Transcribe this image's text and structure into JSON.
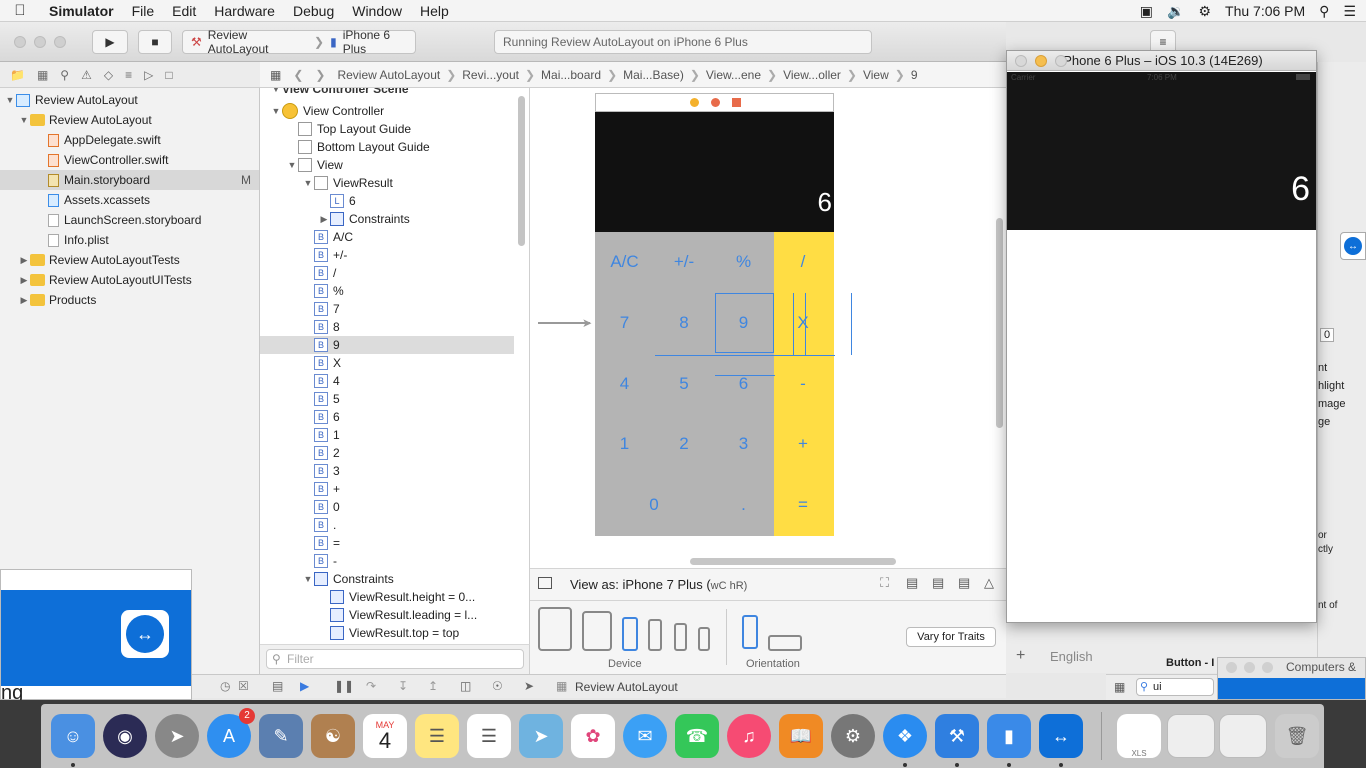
{
  "menubar": {
    "apple_icon": "apple-logo",
    "items": [
      "Simulator",
      "File",
      "Edit",
      "Hardware",
      "Debug",
      "Window",
      "Help"
    ],
    "clock": "Thu 7:06 PM"
  },
  "toolbar": {
    "scheme": "Review AutoLayout",
    "device": "iPhone 6 Plus",
    "activity": "Running Review AutoLayout on iPhone 6 Plus"
  },
  "jumpbar": {
    "crumbs": [
      "Review AutoLayout",
      "Revi...yout",
      "Mai...board",
      "Mai...Base)",
      "View...ene",
      "View...oller",
      "View",
      "9"
    ]
  },
  "navigator": {
    "rows": [
      {
        "label": "Review AutoLayout",
        "kind": "project",
        "indent": 0
      },
      {
        "label": "Review AutoLayout",
        "kind": "folder",
        "indent": 1
      },
      {
        "label": "AppDelegate.swift",
        "kind": "swift",
        "indent": 2
      },
      {
        "label": "ViewController.swift",
        "kind": "swift",
        "indent": 2
      },
      {
        "label": "Main.storyboard",
        "kind": "file",
        "indent": 2,
        "badge": "M",
        "selected": true
      },
      {
        "label": "Assets.xcassets",
        "kind": "assets",
        "indent": 2
      },
      {
        "label": "LaunchScreen.storyboard",
        "kind": "file",
        "indent": 2
      },
      {
        "label": "Info.plist",
        "kind": "file",
        "indent": 2
      },
      {
        "label": "Review AutoLayoutTests",
        "kind": "folder-closed",
        "indent": 0
      },
      {
        "label": "Review AutoLayoutUITests",
        "kind": "folder-closed",
        "indent": 0
      },
      {
        "label": "Products",
        "kind": "folder-closed",
        "indent": 0
      }
    ]
  },
  "outline": {
    "scene_header": "View Controller Scene",
    "rows": [
      {
        "label": "View Controller",
        "icon": "vc",
        "indent": 1
      },
      {
        "label": "Top Layout Guide",
        "icon": "view",
        "indent": 2
      },
      {
        "label": "Bottom Layout Guide",
        "icon": "view",
        "indent": 2
      },
      {
        "label": "View",
        "icon": "view",
        "indent": 2
      },
      {
        "label": "ViewResult",
        "icon": "view",
        "indent": 3
      },
      {
        "label": "6",
        "icon": "L",
        "indent": 4
      },
      {
        "label": "Constraints",
        "icon": "constraints",
        "indent": 4
      },
      {
        "label": "A/C",
        "icon": "B",
        "indent": 3
      },
      {
        "label": "+/-",
        "icon": "B",
        "indent": 3
      },
      {
        "label": "/",
        "icon": "B",
        "indent": 3
      },
      {
        "label": "%",
        "icon": "B",
        "indent": 3
      },
      {
        "label": "7",
        "icon": "B",
        "indent": 3
      },
      {
        "label": "8",
        "icon": "B",
        "indent": 3
      },
      {
        "label": "9",
        "icon": "B",
        "indent": 3,
        "selected": true
      },
      {
        "label": "X",
        "icon": "B",
        "indent": 3
      },
      {
        "label": "4",
        "icon": "B",
        "indent": 3
      },
      {
        "label": "5",
        "icon": "B",
        "indent": 3
      },
      {
        "label": "6",
        "icon": "B",
        "indent": 3
      },
      {
        "label": "1",
        "icon": "B",
        "indent": 3
      },
      {
        "label": "2",
        "icon": "B",
        "indent": 3
      },
      {
        "label": "3",
        "icon": "B",
        "indent": 3
      },
      {
        "label": "+",
        "icon": "B",
        "indent": 3
      },
      {
        "label": "0",
        "icon": "B",
        "indent": 3
      },
      {
        "label": ".",
        "icon": "B",
        "indent": 3
      },
      {
        "label": "=",
        "icon": "B",
        "indent": 3
      },
      {
        "label": "-",
        "icon": "B",
        "indent": 3
      },
      {
        "label": "Constraints",
        "icon": "constraints",
        "indent": 3
      },
      {
        "label": "ViewResult.height = 0...",
        "icon": "constraint",
        "indent": 4
      },
      {
        "label": "ViewResult.leading = l...",
        "icon": "constraint",
        "indent": 4
      },
      {
        "label": "ViewResult.top = top",
        "icon": "constraint",
        "indent": 4
      }
    ],
    "filter_placeholder": "Filter"
  },
  "calculator": {
    "display_value": "6",
    "rows": [
      [
        "A/C",
        "+/-",
        "%",
        "/"
      ],
      [
        "7",
        "8",
        "9",
        "X"
      ],
      [
        "4",
        "5",
        "6",
        "-"
      ],
      [
        "1",
        "2",
        "3",
        "+"
      ],
      [
        "0",
        "",
        ".",
        "="
      ]
    ],
    "colors": {
      "display": "#111111",
      "keys": "#b4b4b4",
      "operators": "#ffdd44",
      "key_text": "#3f86e0"
    }
  },
  "canvas_bottom": {
    "view_as": "View as: iPhone 7 Plus (",
    "size_class": "wC hR)",
    "device_label": "Device",
    "orientation_label": "Orientation",
    "vary_button": "Vary for Traits"
  },
  "statusbar": {
    "label": "Review AutoLayout"
  },
  "simulator": {
    "title": "iPhone 6 Plus – iOS 10.3 (14E269)",
    "carrier": "Carrier",
    "time": "7:06 PM",
    "display_value": "6"
  },
  "inspector": {
    "fragments": [
      "nt",
      "hlight",
      "mage",
      "ge",
      "or",
      "ctly",
      "nt of",
      "0"
    ],
    "language": "English",
    "search_value": "ui",
    "button_label": "Button - I"
  },
  "teamviewer": {
    "right_title": "Computers &",
    "left_text": "ng"
  },
  "dock": {
    "calendar_month": "MAY",
    "calendar_day": "4",
    "appstore_badge": "2",
    "xls_label": "XLS"
  }
}
